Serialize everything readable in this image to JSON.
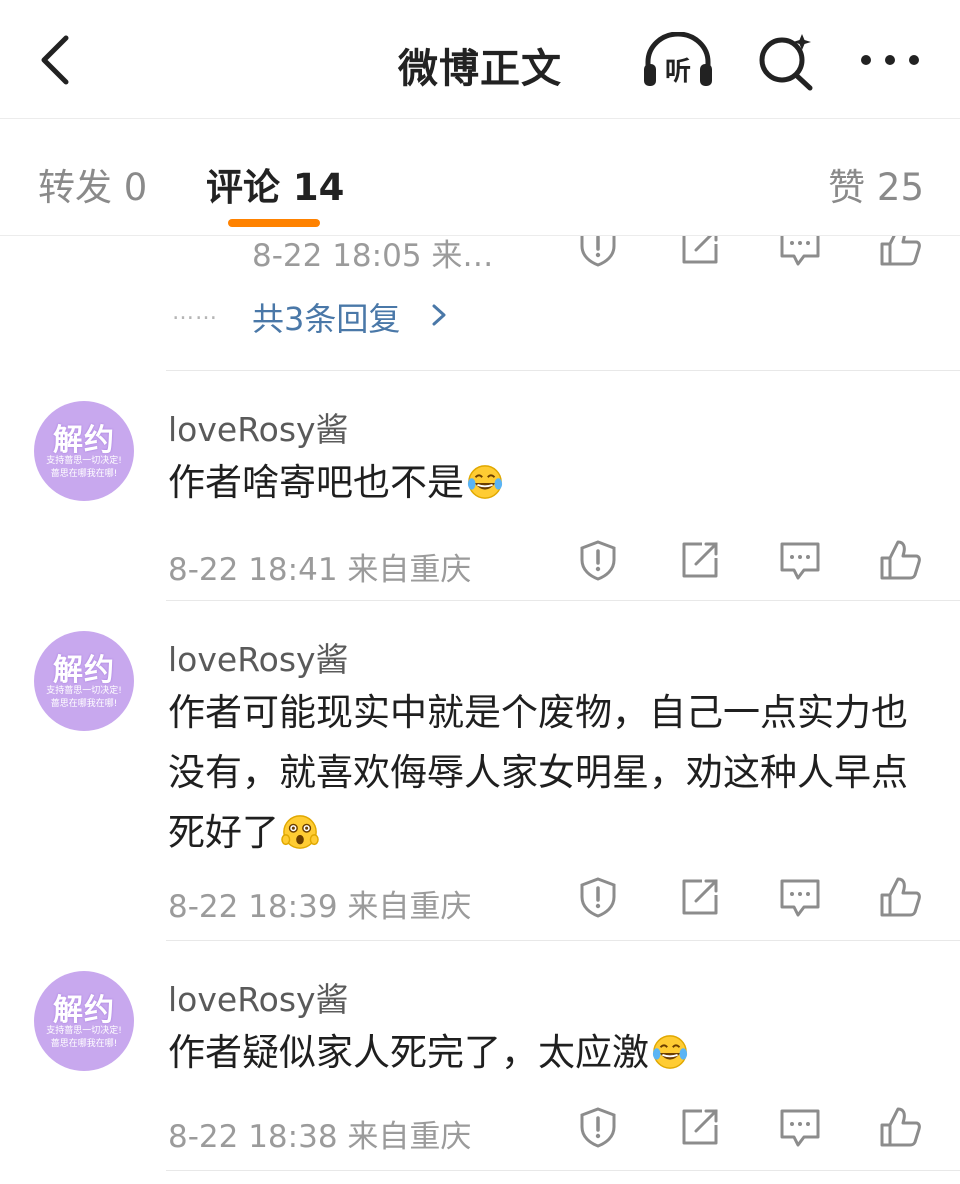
{
  "header": {
    "title": "微博正文",
    "listen_label": "听"
  },
  "tabs": {
    "repost": "转发 0",
    "comment": "评论 14",
    "like": "赞 25"
  },
  "previous_comment": {
    "meta": "8-22 18:05 来…",
    "replies_link": "共3条回复",
    "dots": "……"
  },
  "comments": [
    {
      "username": "loveRosy酱",
      "text": "作者啥寄吧也不是",
      "emoji": "laughing-tears-emoji",
      "meta": "8-22 18:41 来自重庆",
      "avatar_main": "解约",
      "avatar_sub1": "支持蔷思一切决定!",
      "avatar_sub2": "蔷思在哪我在哪!"
    },
    {
      "username": "loveRosy酱",
      "text": "作者可能现实中就是个废物，自己一点实力也没有，就喜欢侮辱人家女明星，劝这种人早点死好了",
      "emoji": "shocked-emoji",
      "meta": "8-22 18:39 来自重庆",
      "avatar_main": "解约",
      "avatar_sub1": "支持蔷思一切决定!",
      "avatar_sub2": "蔷思在哪我在哪!"
    },
    {
      "username": "loveRosy酱",
      "text": "作者疑似家人死完了，太应激",
      "emoji": "laughing-tears-emoji",
      "meta": "8-22 18:38 来自重庆",
      "avatar_main": "解约",
      "avatar_sub1": "支持蔷思一切决定!",
      "avatar_sub2": "蔷思在哪我在哪!"
    }
  ],
  "colors": {
    "accent": "#ff8200",
    "link": "#4a78a8",
    "meta": "#9b9b9b",
    "avatar": "#c8a8ee"
  }
}
